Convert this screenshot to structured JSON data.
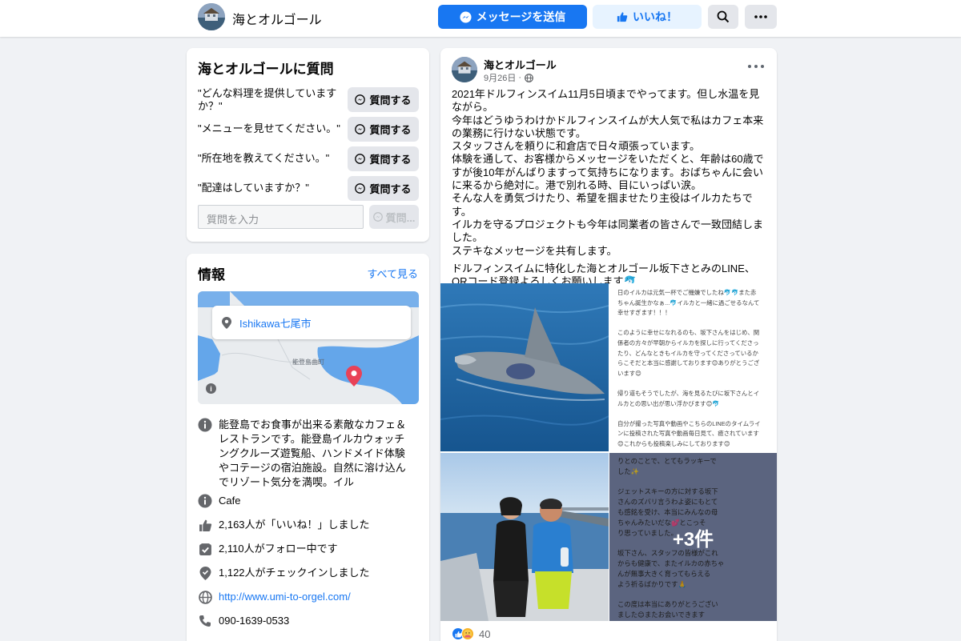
{
  "header": {
    "page_name": "海とオルゴール",
    "message_button": "メッセージを送信",
    "like_button": "いいね！",
    "search_icon": "search-icon",
    "more_icon": "more-icon"
  },
  "questions": {
    "title": "海とオルゴールに質問",
    "items": [
      {
        "text": "\"どんな料理を提供していますか？\"",
        "button": "質問する"
      },
      {
        "text": "\"メニューを見せてください。\"",
        "button": "質問する"
      },
      {
        "text": "\"所在地を教えてください。\"",
        "button": "質問する"
      },
      {
        "text": "\"配達はしていますか？\"",
        "button": "質問する"
      }
    ],
    "input_placeholder": "質問を入力",
    "submit_button": "質問..."
  },
  "info": {
    "title": "情報",
    "see_all": "すべて見る",
    "map_location": "Ishikawa七尾市",
    "map_place_label": "能登島曲町",
    "map_info_badge": "i",
    "description": "能登島でお食事が出来る素敵なカフェ＆レストランです。能登島イルカウォッチングクルーズ遊覧船、ハンドメイド体験やコテージの宿泊施設。自然に溶け込んでリゾート気分を満喫。イル",
    "category": "Cafe",
    "likes": "2,163人が「いいね！」しました",
    "follows": "2,110人がフォロー中です",
    "checkins": "1,122人がチェックインしました",
    "website": "http://www.umi-to-orgel.com/",
    "phone": "090-1639-0533"
  },
  "post": {
    "author": "海とオルゴール",
    "date": "9月26日",
    "body_lines": [
      "2021年ドルフィンスイム11月5日頃までやってます。但し水温を見ながら。",
      "今年はどうゆうわけかドルフィンスイムが大人気で私はカフェ本来の業務に行けない状態です。",
      "スタッフさんを頼りに和倉店で日々頑張っています。",
      "体験を通して、お客様からメッセージをいただくと、年齢は60歳ですが後10年がんばりますって気持ちになります。おばちゃんに会いに来るから絶対に。港で別れる時、目にいっぱい涙。",
      "そんな人を勇気づけたり、希望を掴ませたり主役はイルカたちです。",
      "イルカを守るプロジェクトも今年は同業者の皆さんで一致団結しました。",
      "ステキなメッセージを共有します。"
    ],
    "body_para2": "ドルフィンスイムに特化した海とオルゴール坂下さとみのLINE、QRコード登録よろしくお願いします🐬",
    "note_lines": [
      "日のイルカは元気一杯でご機嫌でしたね🐬🐬また赤",
      "ちゃん誕生かなぁ...🐬イルカと一緒に過ごせるなんて",
      "幸せすぎます！！！",
      "",
      "このように幸せになれるのも、坂下さんをはじめ、関",
      "係者の方々が早朝からイルカを探しに行ってくださっ",
      "たり、どんなときもイルカを守ってくださっているか",
      "らこそだと本当に感謝しております😊ありがとうござ",
      "います😊",
      "",
      "帰り道もそうでしたが、海を見るたびに坂下さんとイ",
      "ルカとの思い出が思い浮かびます😊🐬",
      "",
      "自分が撮った写真や動画やこちらのLINEのタイムライ",
      "ンに投稿された写真や動画毎日見て、癒されています",
      "😊これからも投稿楽しみにしております😊"
    ],
    "chat_lines": [
      "りとのことで、とてもラッキーで",
      "した✨",
      "",
      "ジェットスキーの方に対する坂下",
      "さんのズバリ言うわよ姿にもとて",
      "も感銘を受け、本当にみんなの母",
      "ちゃんみたいだな💕とこっそ",
      "り思っていました。",
      "",
      "坂下さん、スタッフの皆様がこれ",
      "からも健康で、またイルカの赤ちゃ",
      "んが無事大きく育ってもらえる",
      "よう祈るばかりです🙏",
      "",
      "この度は本当にありがとうござい",
      "ました😊またお会いできます"
    ],
    "more_photos": "+3件",
    "reaction_count": "40"
  }
}
